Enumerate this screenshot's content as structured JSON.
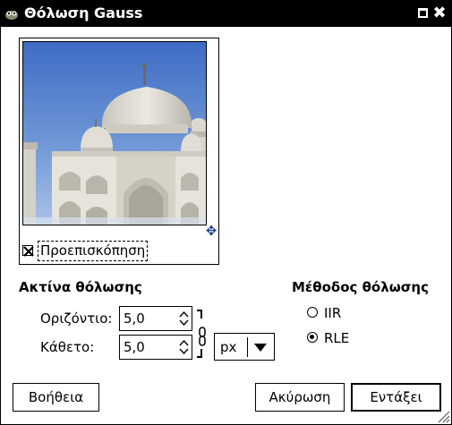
{
  "window": {
    "title": "Θόλωση Gauss",
    "app_icon": "gimp-icon",
    "controls": [
      "maximize-icon",
      "close-icon"
    ]
  },
  "preview": {
    "checkbox_label": "Προεπισκόπηση",
    "checked": true,
    "image_subject": "taj-mahal-photo",
    "navigate_icon": "move-icon"
  },
  "blur_radius": {
    "title": "Ακτίνα θόλωσης",
    "horizontal_label": "Οριζόντιο:",
    "horizontal_value": "5,0",
    "vertical_label": "Κάθετο:",
    "vertical_value": "5,0",
    "chain_icon": "chain-link-icon",
    "unit": "px"
  },
  "method": {
    "title": "Μέθοδος θόλωσης",
    "options": [
      {
        "label": "IIR",
        "selected": false
      },
      {
        "label": "RLE",
        "selected": true
      }
    ]
  },
  "buttons": {
    "help": "Βοήθεια",
    "cancel": "Ακύρωση",
    "ok": "Εντάξει"
  }
}
